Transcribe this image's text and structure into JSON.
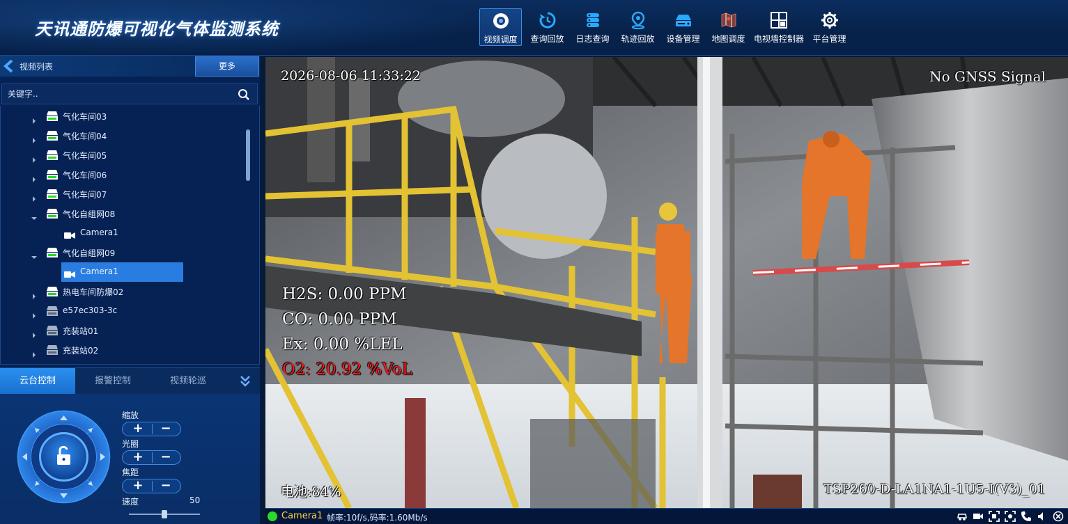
{
  "app": {
    "title": "天讯通防爆可视化气体监测系统"
  },
  "nav": [
    {
      "label": "视频调度",
      "icon": "camera-icon",
      "active": true
    },
    {
      "label": "查询回放",
      "icon": "replay-icon"
    },
    {
      "label": "日志查询",
      "icon": "log-icon"
    },
    {
      "label": "轨迹回放",
      "icon": "location-pin-icon"
    },
    {
      "label": "设备管理",
      "icon": "device-icon"
    },
    {
      "label": "地图调度",
      "icon": "map-icon"
    },
    {
      "label": "电视墙控制器",
      "icon": "video-wall-icon"
    },
    {
      "label": "平台管理",
      "icon": "gear-icon"
    }
  ],
  "sidebar": {
    "title": "视频列表",
    "more_label": "更多",
    "search_placeholder": "关键字..",
    "tree": [
      {
        "label": "气化车间03",
        "type": "group",
        "online": true,
        "expanded": false
      },
      {
        "label": "气化车间04",
        "type": "group",
        "online": true,
        "expanded": false
      },
      {
        "label": "气化车间05",
        "type": "group",
        "online": true,
        "expanded": false
      },
      {
        "label": "气化车间06",
        "type": "group",
        "online": true,
        "expanded": false
      },
      {
        "label": "气化车间07",
        "type": "group",
        "online": true,
        "expanded": false
      },
      {
        "label": "气化自组网08",
        "type": "group",
        "online": true,
        "expanded": true
      },
      {
        "label": "Camera1",
        "type": "camera"
      },
      {
        "label": "气化自组网09",
        "type": "group",
        "online": true,
        "expanded": true
      },
      {
        "label": "Camera1",
        "type": "camera",
        "selected": true
      },
      {
        "label": "热电车间防爆02",
        "type": "group",
        "online": true,
        "expanded": false
      },
      {
        "label": "e57ec303-3c",
        "type": "group",
        "online": false,
        "expanded": false
      },
      {
        "label": "充装站01",
        "type": "group",
        "online": false,
        "expanded": false
      },
      {
        "label": "充装站02",
        "type": "group",
        "online": false,
        "expanded": false
      }
    ]
  },
  "controls": {
    "tabs": [
      "云台控制",
      "报警控制",
      "视频轮巡"
    ],
    "active_tab": 0,
    "zoom_label": "缩放",
    "iris_label": "光圈",
    "focus_label": "焦距",
    "plus": "+",
    "minus": "−",
    "speed_label": "速度",
    "speed_value": "50",
    "speed_max": 100
  },
  "video": {
    "timestamp": "2026-08-06 11:33:22",
    "gnss": "No GNSS Signal",
    "h2s": "H2S: 0.00 PPM",
    "co": "CO: 0.00 PPM",
    "ex": "Ex: 0.00 %LEL",
    "o2": "O2: 20.92 %VoL",
    "battery": "电池:84%",
    "device": "TSP260-D-LA1NA1-1U5-I(V3)_01"
  },
  "status": {
    "camera": "Camera1",
    "rate": "帧率:10f/s,码率:1.60Mb/s"
  },
  "colors": {
    "accent": "#2a7de0",
    "online": "#2bd92b",
    "o2_alert": "#ff1a1a"
  }
}
